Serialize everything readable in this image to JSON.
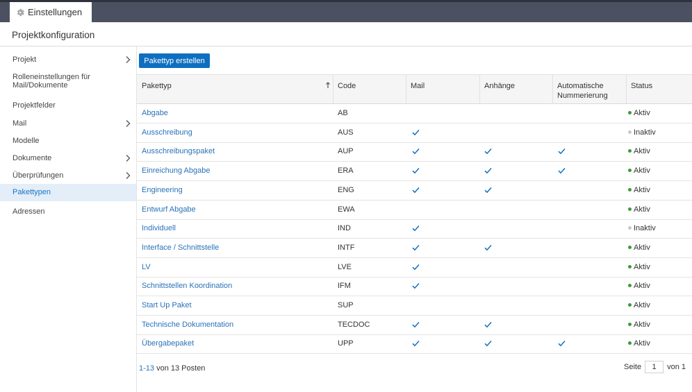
{
  "header": {
    "tab_label": "Einstellungen",
    "page_title": "Projektkonfiguration"
  },
  "sidebar": {
    "items": [
      {
        "label": "Projekt",
        "has_arrow": true,
        "active": false
      },
      {
        "label": "Rolleneinstellungen für Mail/Dokumente",
        "has_arrow": false,
        "active": false
      },
      {
        "label": "Projektfelder",
        "has_arrow": false,
        "active": false
      },
      {
        "label": "Mail",
        "has_arrow": true,
        "active": false
      },
      {
        "label": "Modelle",
        "has_arrow": false,
        "active": false
      },
      {
        "label": "Dokumente",
        "has_arrow": true,
        "active": false
      },
      {
        "label": "Überprüfungen",
        "has_arrow": true,
        "active": false
      },
      {
        "label": "Pakettypen",
        "has_arrow": false,
        "active": true
      },
      {
        "label": "Adressen",
        "has_arrow": false,
        "active": false
      }
    ]
  },
  "toolbar": {
    "create_label": "Pakettyp erstellen"
  },
  "table": {
    "columns": [
      "Pakettyp",
      "Code",
      "Mail",
      "Anhänge",
      "Automatische Nummerierung",
      "Status"
    ],
    "rows": [
      {
        "name": "Abgabe",
        "code": "AB",
        "mail": false,
        "attachments": false,
        "numbering": false,
        "status": "Aktiv"
      },
      {
        "name": "Ausschreibung",
        "code": "AUS",
        "mail": true,
        "attachments": false,
        "numbering": false,
        "status": "Inaktiv"
      },
      {
        "name": "Ausschreibungspaket",
        "code": "AUP",
        "mail": true,
        "attachments": true,
        "numbering": true,
        "status": "Aktiv"
      },
      {
        "name": "Einreichung Abgabe",
        "code": "ERA",
        "mail": true,
        "attachments": true,
        "numbering": true,
        "status": "Aktiv"
      },
      {
        "name": "Engineering",
        "code": "ENG",
        "mail": true,
        "attachments": true,
        "numbering": false,
        "status": "Aktiv"
      },
      {
        "name": "Entwurf Abgabe",
        "code": "EWA",
        "mail": false,
        "attachments": false,
        "numbering": false,
        "status": "Aktiv"
      },
      {
        "name": "Individuell",
        "code": "IND",
        "mail": true,
        "attachments": false,
        "numbering": false,
        "status": "Inaktiv"
      },
      {
        "name": "Interface / Schnittstelle",
        "code": "INTF",
        "mail": true,
        "attachments": true,
        "numbering": false,
        "status": "Aktiv"
      },
      {
        "name": "LV",
        "code": "LVE",
        "mail": true,
        "attachments": false,
        "numbering": false,
        "status": "Aktiv"
      },
      {
        "name": "Schnittstellen Koordination",
        "code": "IFM",
        "mail": true,
        "attachments": false,
        "numbering": false,
        "status": "Aktiv"
      },
      {
        "name": "Start Up Paket",
        "code": "SUP",
        "mail": false,
        "attachments": false,
        "numbering": false,
        "status": "Aktiv"
      },
      {
        "name": "Technische Dokumentation",
        "code": "TECDOC",
        "mail": true,
        "attachments": true,
        "numbering": false,
        "status": "Aktiv"
      },
      {
        "name": "Übergabepaket",
        "code": "UPP",
        "mail": true,
        "attachments": true,
        "numbering": true,
        "status": "Aktiv"
      }
    ]
  },
  "pagination": {
    "range": "1-13",
    "total_text": "von 13 Posten",
    "page_label": "Seite",
    "current_page": "1",
    "of_text": "von 1"
  },
  "colors": {
    "accent": "#0e6fc0",
    "link": "#2a72b8",
    "active_status": "#3c9a3c",
    "inactive_status": "#c8c8c8",
    "topbar": "#4b5160"
  },
  "icons": {
    "tab": "gear-icon",
    "nav_arrow": "chevron-right-icon",
    "sort": "sort-up-arrow-icon",
    "check": "check-icon",
    "status": "status-dot-icon"
  }
}
